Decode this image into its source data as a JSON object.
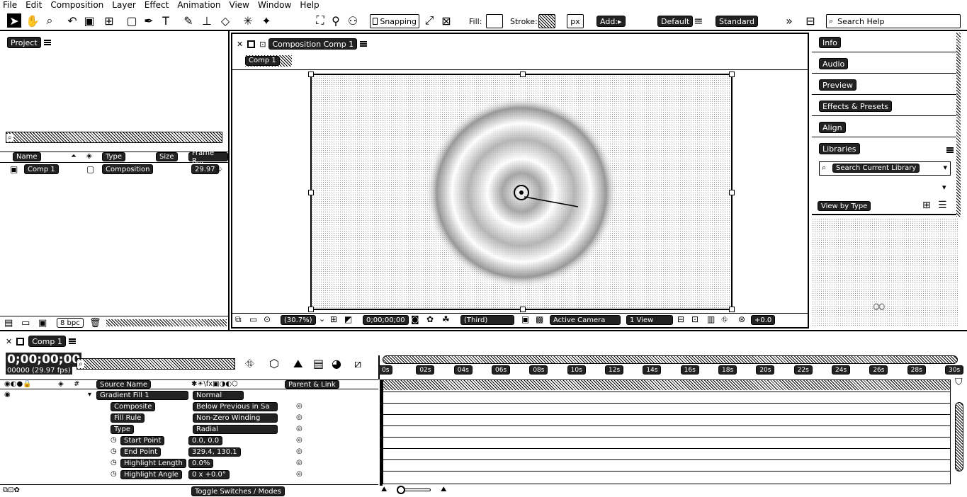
{
  "menu": [
    "File",
    "Edit",
    "Composition",
    "Layer",
    "Effect",
    "Animation",
    "View",
    "Window",
    "Help"
  ],
  "toolbar": {
    "snapping": "Snapping",
    "fill": "Fill:",
    "stroke": "Stroke:",
    "px": "px",
    "add": "Add:",
    "workspace_default": "Default",
    "workspace_standard": "Standard",
    "search_placeholder": "Search Help"
  },
  "project": {
    "title": "Project",
    "search_placeholder": "",
    "columns": [
      "Name",
      "Type",
      "Size",
      "Frame R..."
    ],
    "items": [
      {
        "name": "Comp 1",
        "type": "Composition",
        "frame_rate": "29.97"
      }
    ],
    "bpc": "8 bpc"
  },
  "composition": {
    "tab_title": "Composition Comp 1",
    "breadcrumb": "Comp 1",
    "zoom": "(30.7%)",
    "timecode": "0;00;00;00",
    "resolution": "(Third)",
    "camera": "Active Camera",
    "views": "1 View",
    "exposure": "+0.0"
  },
  "right_panels": {
    "items": [
      "Info",
      "Audio",
      "Preview",
      "Effects & Presets",
      "Align",
      "Libraries"
    ],
    "libraries_search": "Search Current Library",
    "view_by_type": "View by Type"
  },
  "timeline": {
    "tab": "Comp 1",
    "timecode": "0;00;00;00",
    "frame_info": "00000 (29.97 fps)",
    "search_placeholder": "",
    "ruler": [
      "0s",
      "02s",
      "04s",
      "06s",
      "08s",
      "10s",
      "12s",
      "14s",
      "16s",
      "18s",
      "20s",
      "22s",
      "24s",
      "26s",
      "28s",
      "30s"
    ],
    "col_source": "Source Name",
    "col_parent": "Parent & Link",
    "layer_name": "Gradient Fill 1",
    "mode": "Normal",
    "properties": [
      {
        "name": "Composite",
        "value": "Below Previous in Sa"
      },
      {
        "name": "Fill Rule",
        "value": "Non-Zero Winding"
      },
      {
        "name": "Type",
        "value": "Radial"
      },
      {
        "name": "Start Point",
        "value": "0.0, 0.0"
      },
      {
        "name": "End Point",
        "value": "329.4, 130.1"
      },
      {
        "name": "Highlight Length",
        "value": "0.0%"
      },
      {
        "name": "Highlight Angle",
        "value": "0 x +0.0°"
      }
    ],
    "toggle": "Toggle Switches / Modes"
  }
}
